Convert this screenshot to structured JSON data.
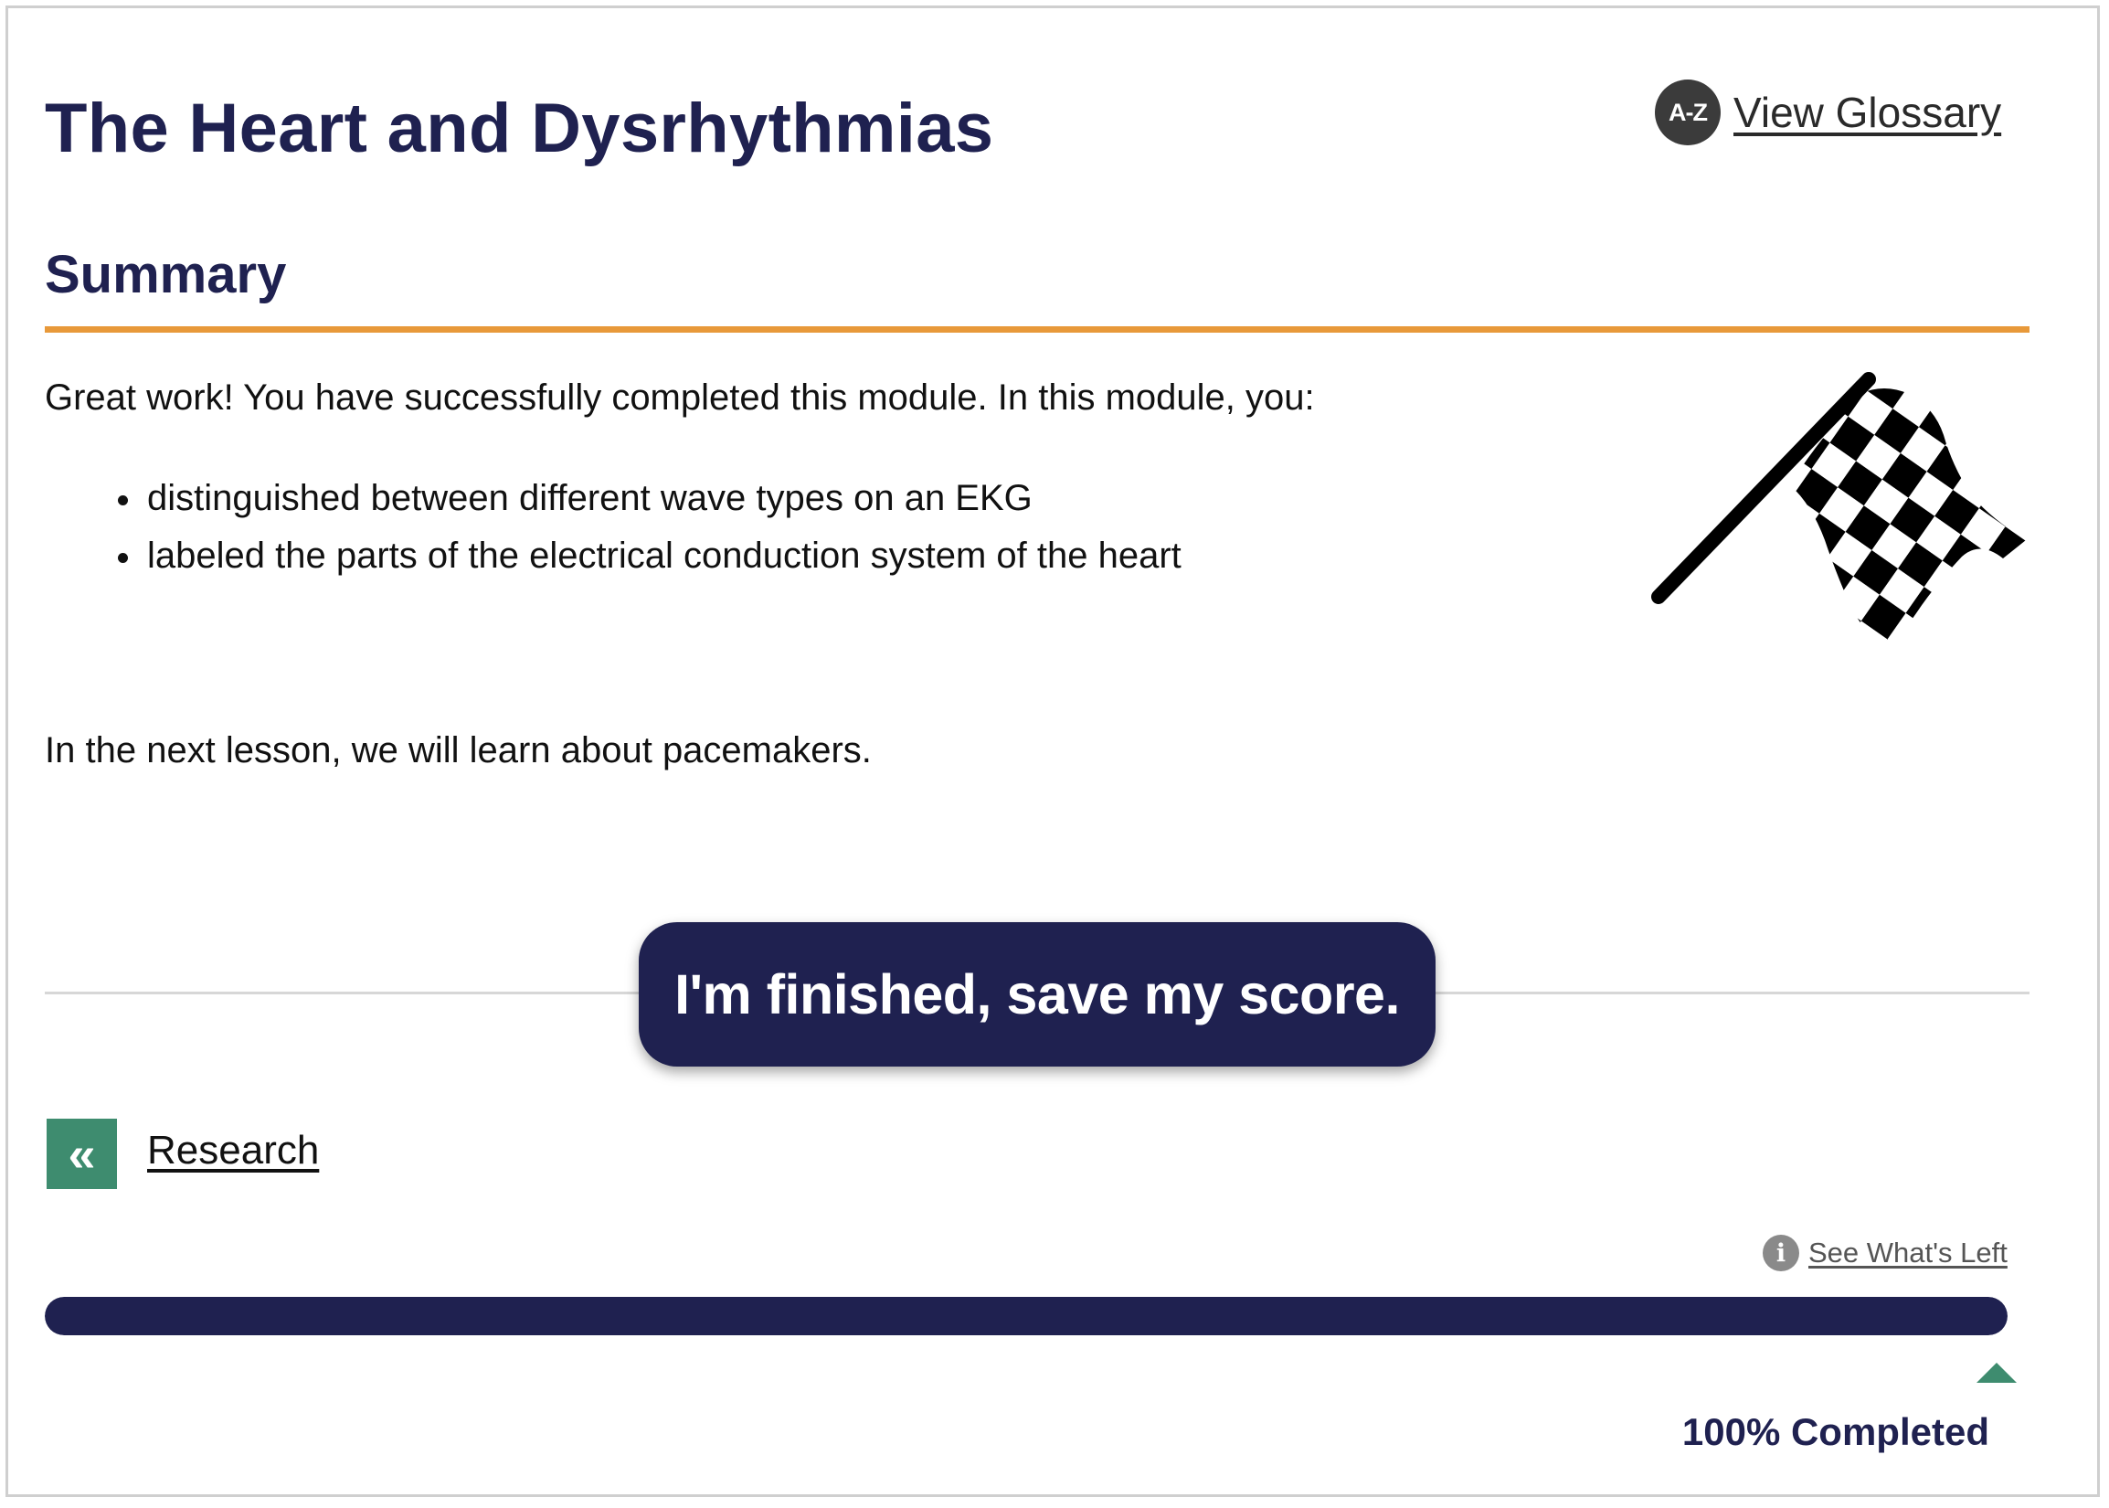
{
  "header": {
    "title": "The Heart and Dysrhythmias",
    "glossary_badge": "A-Z",
    "glossary_label": "View Glossary"
  },
  "summary": {
    "heading": "Summary",
    "intro": "Great work! You have successfully completed this module.  In this module, you:",
    "bullets": [
      "distinguished between different wave types on an EKG",
      "labeled the parts of the electrical conduction system of the heart"
    ],
    "next": "In the next lesson, we will learn about pacemakers.",
    "image_icon": "checkered-flag-icon"
  },
  "finish_button": {
    "label": "I'm finished, save my score."
  },
  "navigation": {
    "back_glyph": "«",
    "back_label": "Research"
  },
  "progress": {
    "info_glyph": "i",
    "whats_left_label": "See What's Left",
    "percent": 100,
    "label": "100% Completed"
  },
  "colors": {
    "navy": "#1f2150",
    "orange": "#e8993a",
    "green": "#3e8c6f"
  }
}
